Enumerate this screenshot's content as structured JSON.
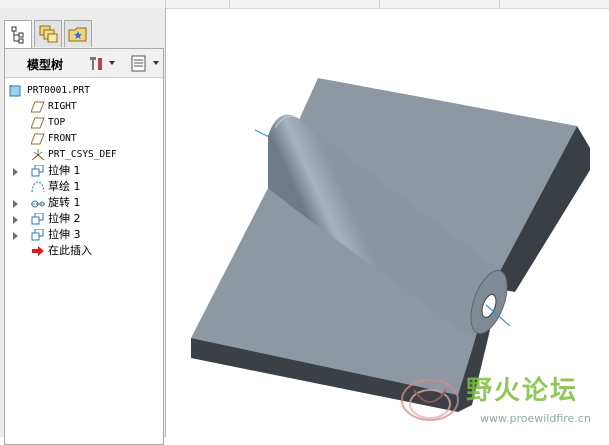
{
  "panel": {
    "tree_title": "模型树",
    "tabs": [
      {
        "name": "model-tree-tab",
        "icon": "tree-icon",
        "active": true
      },
      {
        "name": "layers-tab",
        "icon": "layers-icon",
        "active": false
      },
      {
        "name": "favorites-tab",
        "icon": "folder-star-icon",
        "active": false
      }
    ]
  },
  "tree": {
    "items": [
      {
        "label": "PRT0001.PRT",
        "icon": "part-icon",
        "expandable": false
      },
      {
        "label": "RIGHT",
        "icon": "datum-plane-icon",
        "expandable": false
      },
      {
        "label": "TOP",
        "icon": "datum-plane-icon",
        "expandable": false
      },
      {
        "label": "FRONT",
        "icon": "datum-plane-icon",
        "expandable": false
      },
      {
        "label": "PRT_CSYS_DEF",
        "icon": "coordinate-system-icon",
        "expandable": false
      },
      {
        "label": "拉伸 1",
        "icon": "extrude-icon",
        "expandable": true
      },
      {
        "label": "草绘 1",
        "icon": "sketch-icon",
        "expandable": false
      },
      {
        "label": "旋转 1",
        "icon": "revolve-icon",
        "expandable": true
      },
      {
        "label": "拉伸 2",
        "icon": "extrude-icon",
        "expandable": true
      },
      {
        "label": "拉伸 3",
        "icon": "extrude-icon",
        "expandable": true
      },
      {
        "label": "在此插入",
        "icon": "insert-here-arrow-icon",
        "expandable": false
      }
    ]
  },
  "watermark": {
    "title": "野火论坛",
    "url": "www.proewildfire.cn"
  },
  "colors": {
    "model_top": "#8e98a2",
    "model_side": "#3a3f45",
    "axis": "#2a9bd0",
    "watermark_green": "#7dbd3e"
  }
}
